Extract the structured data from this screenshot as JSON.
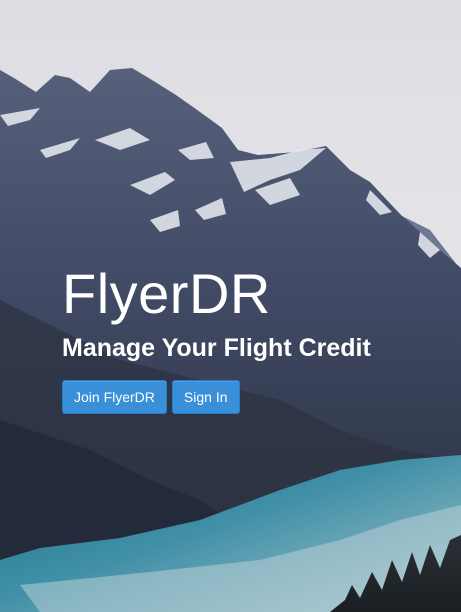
{
  "hero": {
    "brand": "FlyerDR",
    "tagline": "Manage Your Flight Credit"
  },
  "actions": {
    "join_label": "Join FlyerDR",
    "signin_label": "Sign In"
  },
  "colors": {
    "button": "#3a8fd9",
    "lake": "#3f8fa6",
    "sky": "#e9e6ea"
  }
}
